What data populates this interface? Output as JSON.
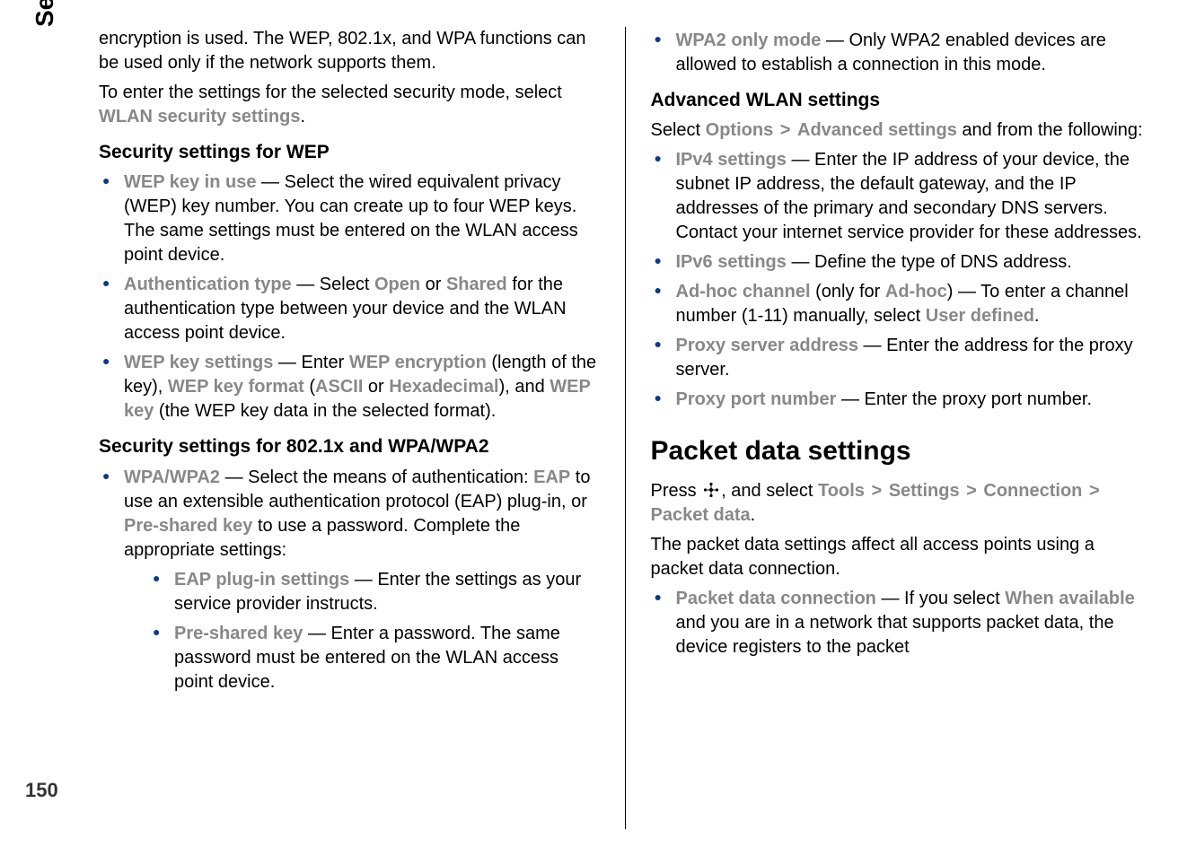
{
  "sidebar": {
    "tab": "Settings",
    "page_number": "150"
  },
  "colL": {
    "p1": "encryption is used. The WEP, 802.1x, and WPA functions can be used only if the network supports them.",
    "p2a": "To enter the settings for the selected security mode, select ",
    "p2_ui": "WLAN security settings",
    "h1": "Security settings for WEP",
    "wep_key_in_use": "WEP key in use",
    "wep_key_in_use_txt": " — Select the wired equivalent privacy (WEP) key number. You can create up to four WEP keys. The same settings must be entered on the WLAN access point device.",
    "auth_type": "Authentication type",
    "auth_type_txt1": " — Select ",
    "auth_open": "Open",
    "auth_type_txt2": " or ",
    "auth_shared": "Shared",
    "auth_type_txt3": " for the authentication type between your device and the WLAN access point device.",
    "wep_key_settings": "WEP key settings",
    "wep_key_settings_txt1": " — Enter ",
    "wep_encryption": "WEP encryption",
    "wep_key_settings_txt2": " (length of the key), ",
    "wep_key_format": "WEP key format",
    "wep_key_settings_txt3": " (",
    "ascii": "ASCII",
    "wep_key_settings_txt4": " or ",
    "hex": "Hexadecimal",
    "wep_key_settings_txt5": "), and ",
    "wep_key": "WEP key",
    "wep_key_settings_txt6": " (the WEP key data in the selected format).",
    "h2": "Security settings for 802.1x and WPA/WPA2",
    "wpa": "WPA/WPA2",
    "wpa_txt1": " — Select the means of authentication: ",
    "eap": "EAP",
    "wpa_txt2": " to use an extensible authentication protocol (EAP) plug-in, or ",
    "psk": "Pre-shared key",
    "wpa_txt3": " to use a password. Complete the appropriate settings:",
    "eap_plugin": "EAP plug-in settings",
    "eap_plugin_txt": " — Enter the settings as your service provider instructs.",
    "psk2": "Pre-shared key",
    "psk2_txt": " — Enter a password. The same password must be entered on the WLAN access point device."
  },
  "colR": {
    "wpa2_only": "WPA2 only mode",
    "wpa2_only_txt": " — Only WPA2 enabled devices are allowed to establish a connection in this mode.",
    "h1": "Advanced WLAN settings",
    "p1a": "Select ",
    "options": "Options",
    "advanced_settings": "Advanced settings",
    "p1b": " and from the following:",
    "ipv4": "IPv4 settings",
    "ipv4_txt": " — Enter the IP address of your device, the subnet IP address, the default gateway, and the IP addresses of the primary and secondary DNS servers. Contact your internet service provider for these addresses.",
    "ipv6": "IPv6 settings",
    "ipv6_txt": " — Define the type of DNS address.",
    "adhoc_channel": "Ad-hoc channel",
    "adhoc_txt1": " (only for ",
    "adhoc": "Ad-hoc",
    "adhoc_txt2": ") — To enter a channel number (1-11) manually, select ",
    "user_defined": "User defined",
    "proxy_addr": "Proxy server address",
    "proxy_addr_txt": " — Enter the address for the proxy server.",
    "proxy_port": "Proxy port number",
    "proxy_port_txt": " — Enter the proxy port number.",
    "h2": "Packet data settings",
    "p2a": "Press ",
    "p2b": ", and select ",
    "tools": "Tools",
    "settings": "Settings",
    "connection": "Connection",
    "packet_data": "Packet data",
    "p3": "The packet data settings affect all access points using a packet data connection.",
    "pdc": "Packet data connection",
    "pdc_txt1": " — If you select ",
    "when_available": "When available",
    "pdc_txt2": " and you are in a network that supports packet data, the device registers to the packet"
  }
}
